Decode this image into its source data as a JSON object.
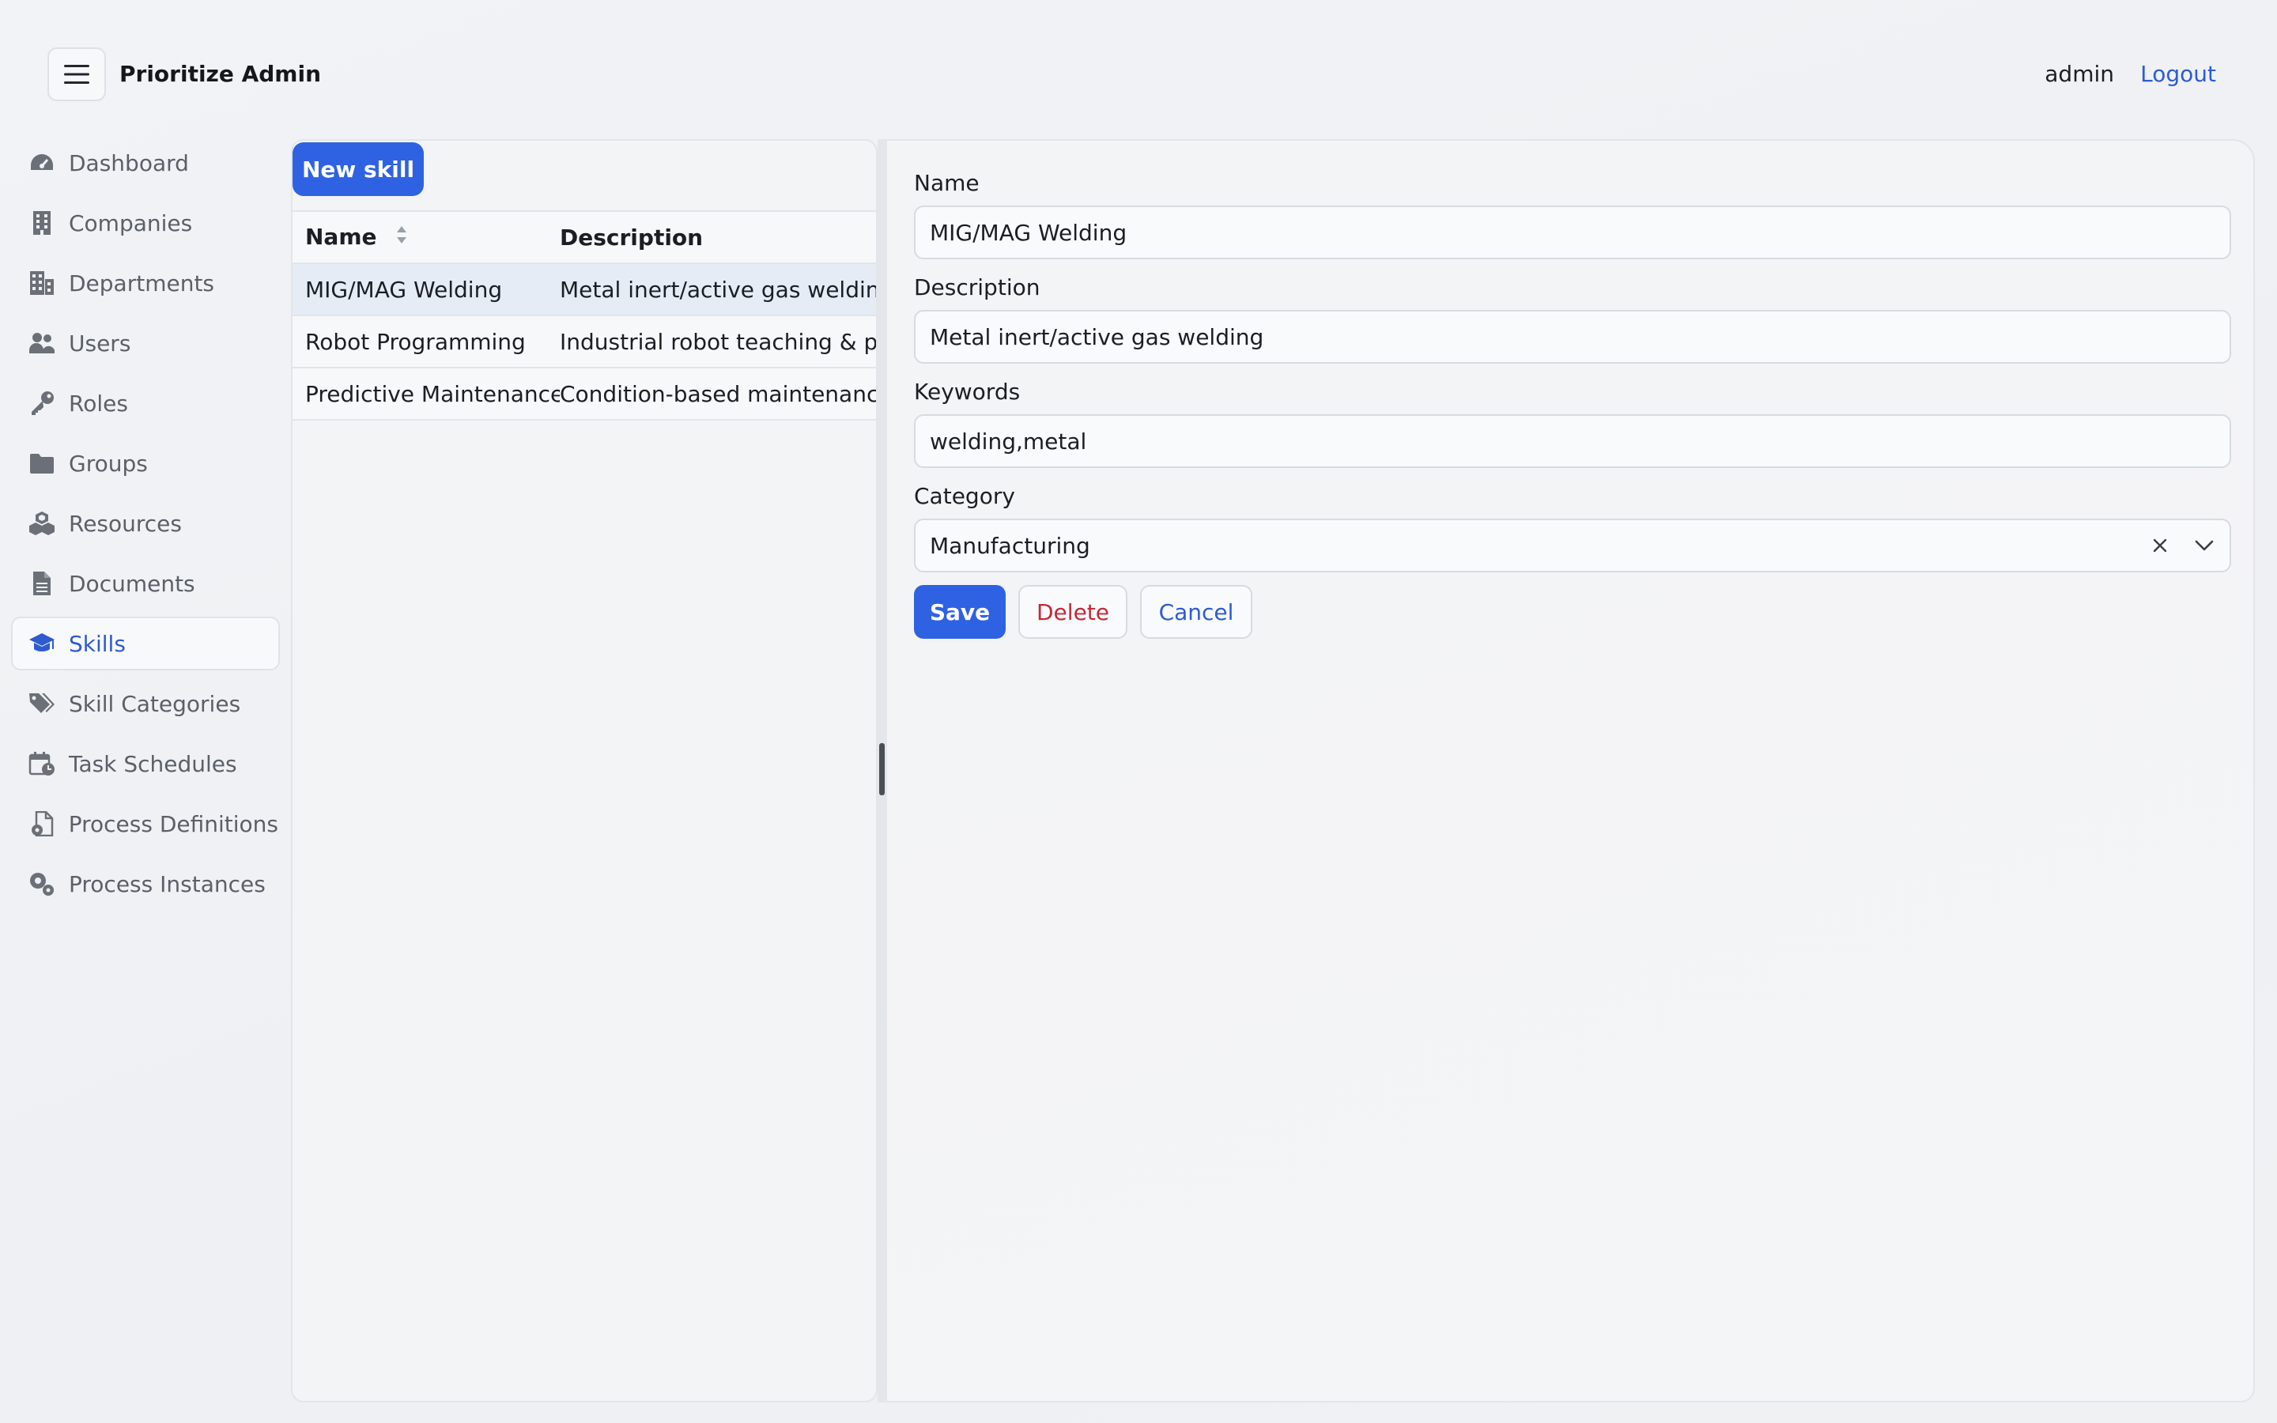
{
  "header": {
    "app_title": "Prioritize Admin",
    "user": "admin",
    "logout_label": "Logout"
  },
  "sidebar": {
    "items": [
      {
        "label": "Dashboard",
        "icon": "dashboard-gauge-icon"
      },
      {
        "label": "Companies",
        "icon": "building-icon"
      },
      {
        "label": "Departments",
        "icon": "buildings-icon"
      },
      {
        "label": "Users",
        "icon": "users-icon"
      },
      {
        "label": "Roles",
        "icon": "key-icon"
      },
      {
        "label": "Groups",
        "icon": "folder-icon"
      },
      {
        "label": "Resources",
        "icon": "cubes-icon"
      },
      {
        "label": "Documents",
        "icon": "document-icon"
      },
      {
        "label": "Skills",
        "icon": "graduation-cap-icon",
        "active": true
      },
      {
        "label": "Skill Categories",
        "icon": "tags-icon"
      },
      {
        "label": "Task Schedules",
        "icon": "calendar-clock-icon"
      },
      {
        "label": "Process Definitions",
        "icon": "file-gear-icon"
      },
      {
        "label": "Process Instances",
        "icon": "gears-icon"
      }
    ]
  },
  "list": {
    "new_button_label": "New skill",
    "columns": {
      "name": "Name",
      "description": "Description"
    },
    "rows": [
      {
        "name": "MIG/MAG Welding",
        "description": "Metal inert/active gas welding",
        "selected": true
      },
      {
        "name": "Robot Programming",
        "description": "Industrial robot teaching & pro"
      },
      {
        "name": "Predictive Maintenance",
        "description": "Condition-based maintenance"
      }
    ]
  },
  "form": {
    "name_label": "Name",
    "name_value": "MIG/MAG Welding",
    "description_label": "Description",
    "description_value": "Metal inert/active gas welding",
    "keywords_label": "Keywords",
    "keywords_value": "welding,metal",
    "category_label": "Category",
    "category_value": "Manufacturing",
    "save_label": "Save",
    "delete_label": "Delete",
    "cancel_label": "Cancel"
  },
  "colors": {
    "accent": "#2f62e3",
    "link": "#2d5bd3",
    "danger": "#c22a36",
    "selected_row": "#e6ecf6"
  }
}
